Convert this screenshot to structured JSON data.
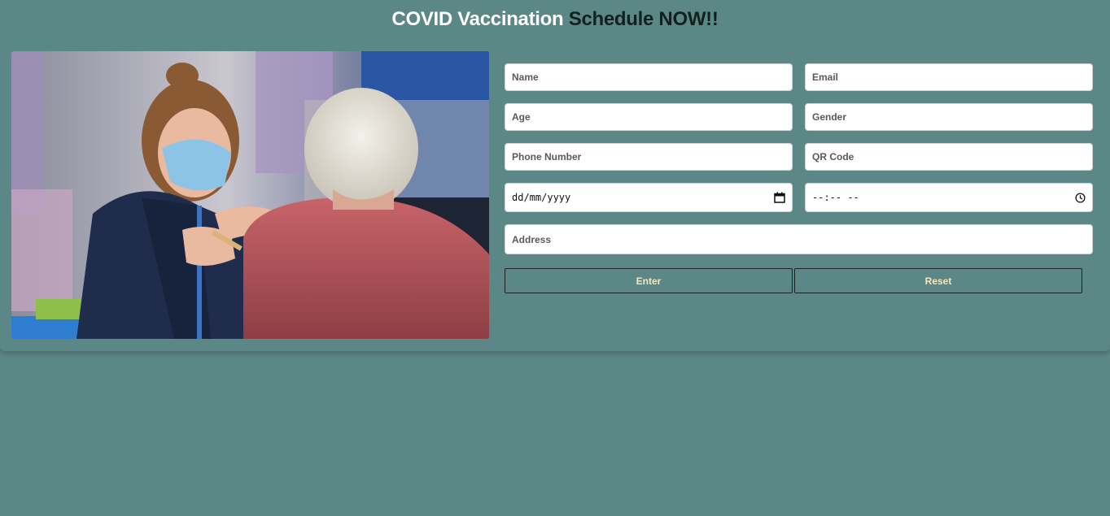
{
  "header": {
    "title_part1": "COVID Vaccination ",
    "title_part2": "Schedule NOW!!"
  },
  "photo": {
    "alt": "Nurse wearing mask vaccinating an elderly man"
  },
  "form": {
    "name_placeholder": "Name",
    "email_placeholder": "Email",
    "age_placeholder": "Age",
    "gender_placeholder": "Gender",
    "phone_placeholder": "Phone Number",
    "qr_placeholder": "QR Code",
    "date_value": "dd/mm/yyyy",
    "time_value": "--:-- --",
    "address_placeholder": "Address",
    "enter_label": "Enter",
    "reset_label": "Reset"
  },
  "colors": {
    "background": "#5b8886",
    "button_text": "#f4e7b8",
    "title_white": "#ffffff",
    "title_dark": "#14201f"
  }
}
